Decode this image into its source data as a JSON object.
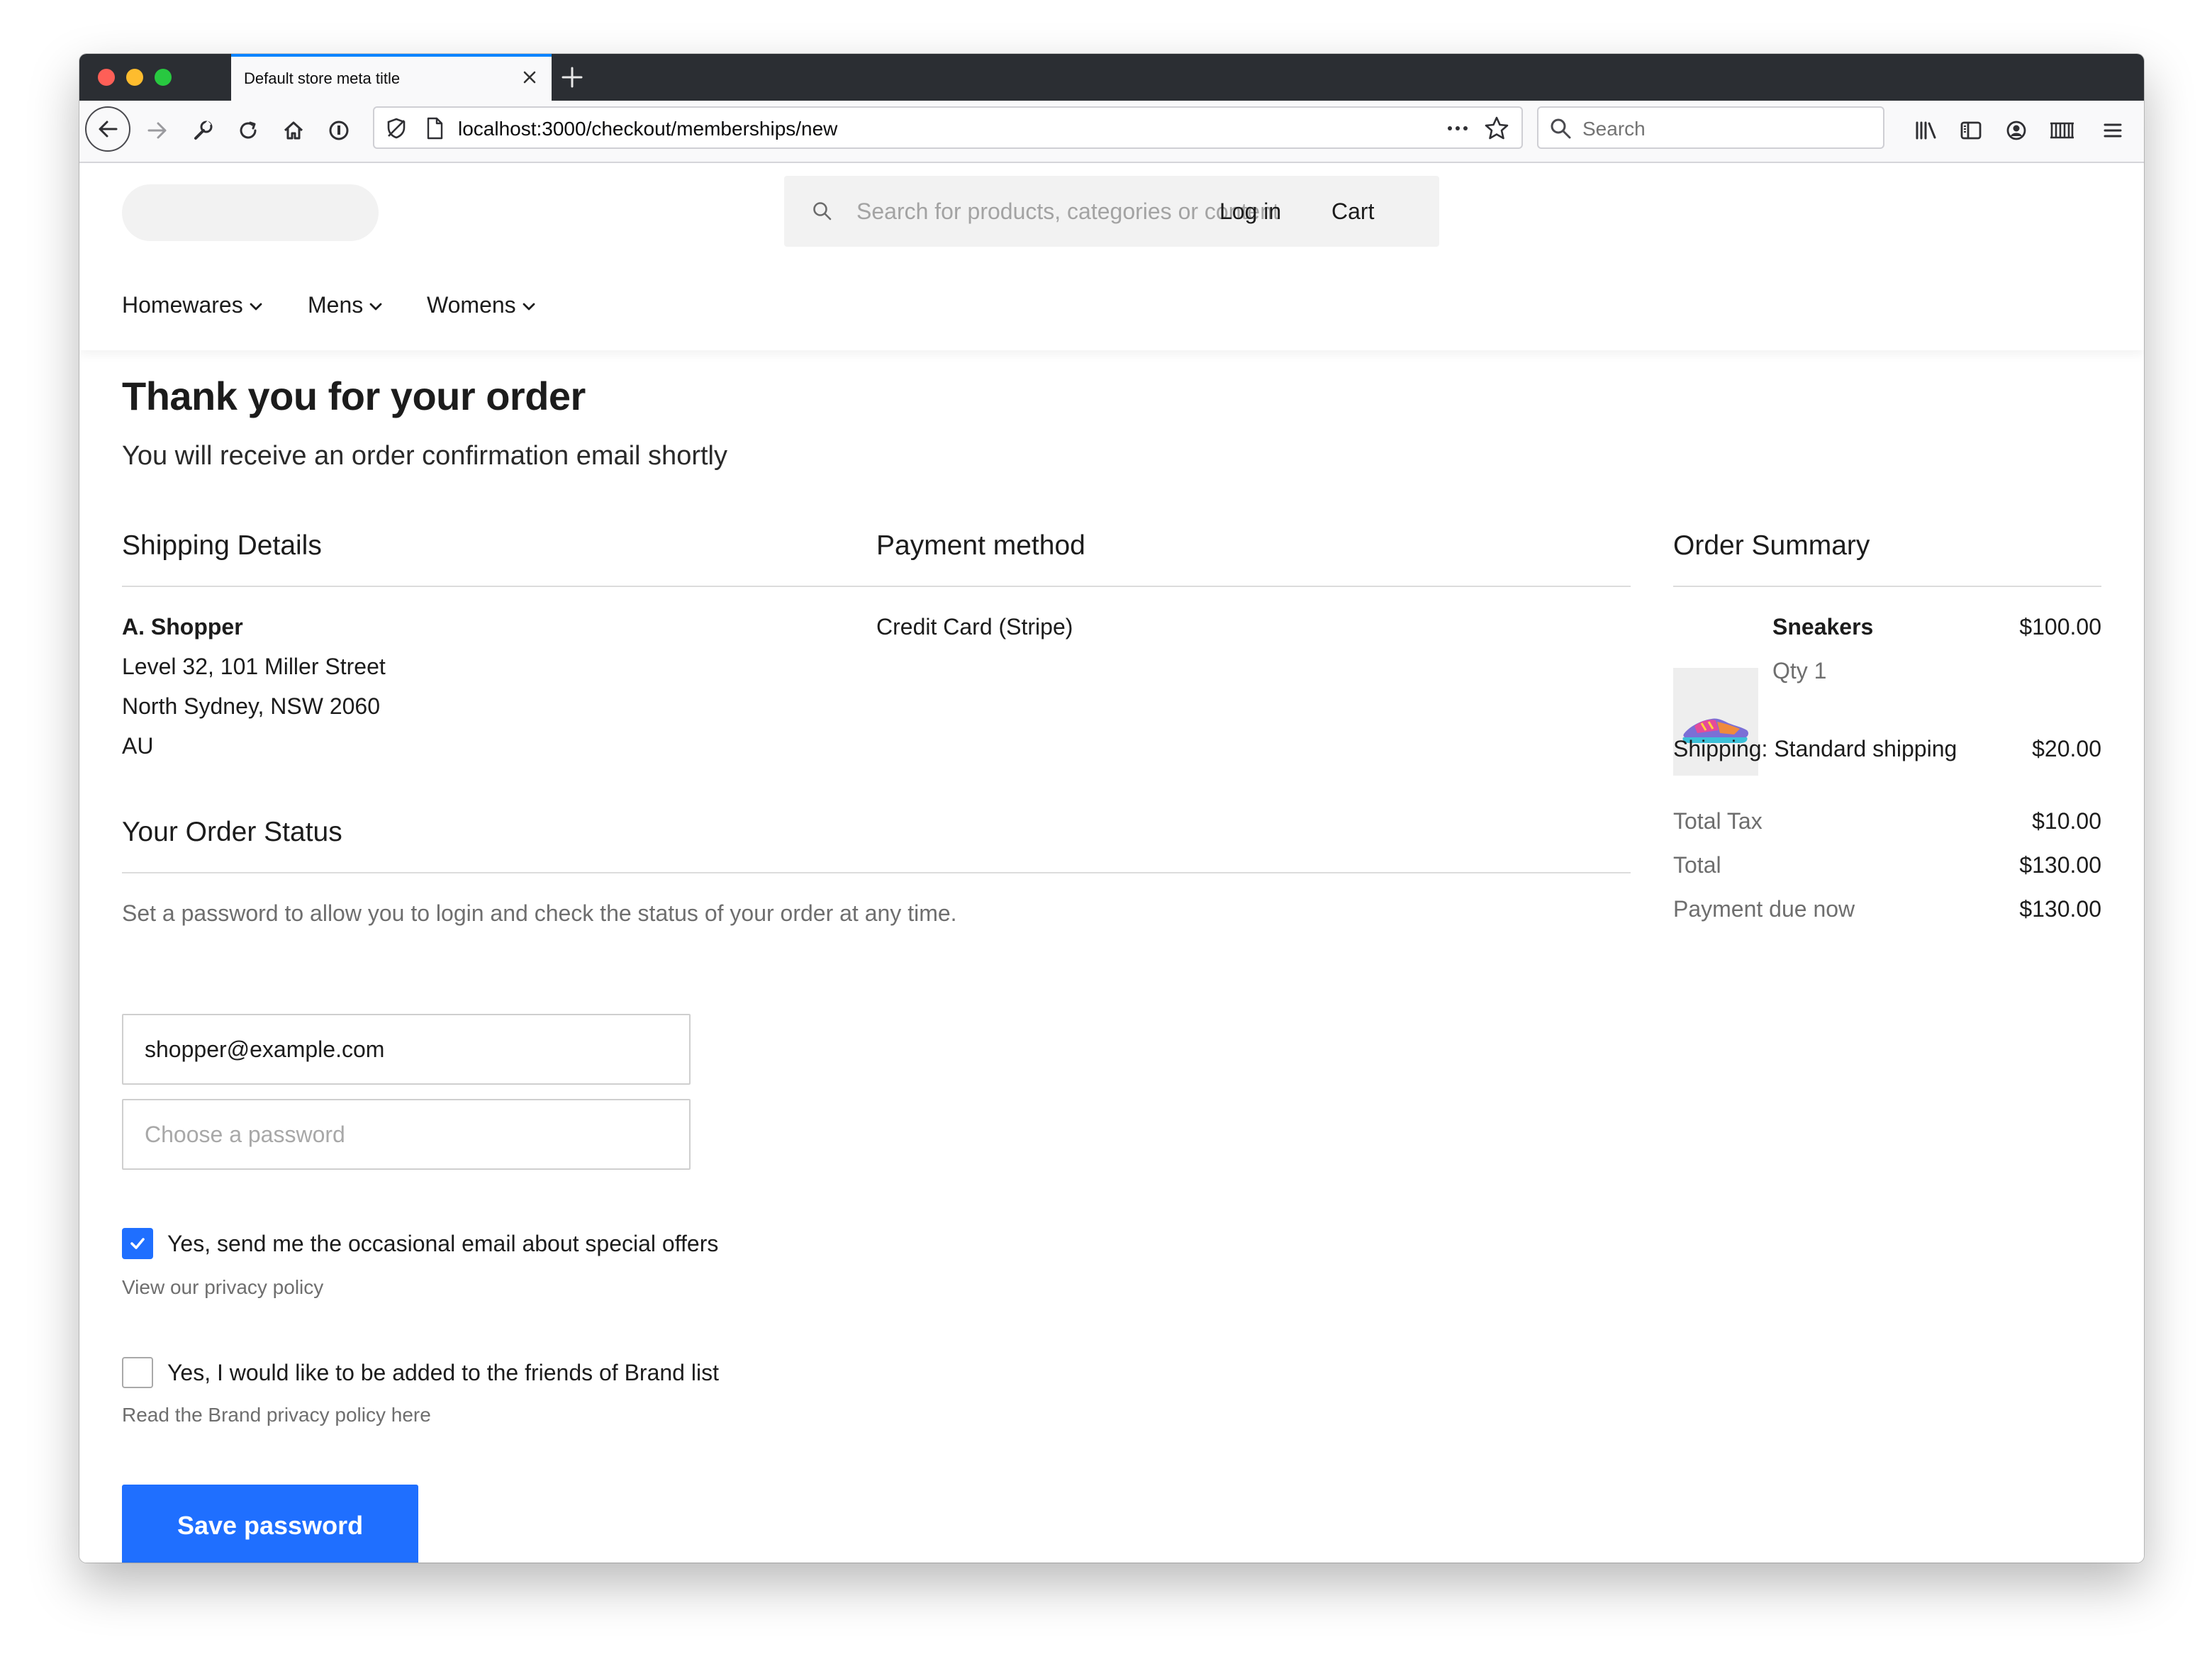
{
  "browser": {
    "tab_title": "Default store meta title",
    "url": "localhost:3000/checkout/memberships/new",
    "search_placeholder": "Search"
  },
  "header": {
    "search_placeholder": "Search for products, categories or content",
    "login": "Log in",
    "cart": "Cart",
    "nav": [
      "Homewares",
      "Mens",
      "Womens"
    ]
  },
  "confirmation": {
    "title": "Thank you for your order",
    "subtitle": "You will receive an order confirmation email shortly"
  },
  "shipping": {
    "heading": "Shipping Details",
    "name": "A. Shopper",
    "line1": "Level 32, 101 Miller Street",
    "line2": "North Sydney, NSW 2060",
    "country": "AU"
  },
  "payment": {
    "heading": "Payment method",
    "method": "Credit Card (Stripe)"
  },
  "order_status": {
    "heading": "Your Order Status",
    "description": "Set a password to allow you to login and check the status of your order at any time.",
    "email_value": "shopper@example.com",
    "password_placeholder": "Choose a password",
    "offers_label": "Yes, send me the occasional email about special offers",
    "offers_checked": true,
    "privacy_link": "View our privacy policy",
    "friends_label": "Yes, I would like to be added to the friends of Brand list",
    "friends_checked": false,
    "brand_privacy_link": "Read the Brand privacy policy here",
    "save_button": "Save password"
  },
  "summary": {
    "heading": "Order Summary",
    "item_name": "Sneakers",
    "item_qty": "Qty 1",
    "item_price": "$100.00",
    "shipping_label": "Shipping: Standard shipping",
    "shipping_price": "$20.00",
    "tax_label": "Total Tax",
    "tax_value": "$10.00",
    "total_label": "Total",
    "total_value": "$130.00",
    "due_label": "Payment due now",
    "due_value": "$130.00"
  },
  "colors": {
    "accent": "#1f6fff",
    "tab_accent": "#0a84ff"
  }
}
